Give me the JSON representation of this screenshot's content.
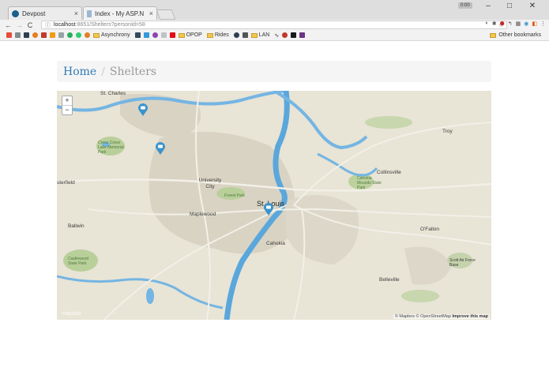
{
  "browser": {
    "tabs": [
      {
        "title": "Devpost",
        "active": false
      },
      {
        "title": "Index - My ASP.NET",
        "active": true
      }
    ],
    "profile_badge": "0:00",
    "url_host": "localhost",
    "url_rest": ":8651/Shelters?personId=58",
    "bookmarks": [
      {
        "label": "Asynchrony",
        "type": "folder"
      },
      {
        "label": "OPOP",
        "type": "folder"
      },
      {
        "label": "Rides",
        "type": "folder"
      },
      {
        "label": "LAN",
        "type": "folder"
      }
    ],
    "other_bookmarks": "Other bookmarks"
  },
  "breadcrumb": {
    "home": "Home",
    "separator": "/",
    "current": "Shelters"
  },
  "map": {
    "zoom_in": "+",
    "zoom_out": "−",
    "attribution_mapbox": "© Mapbox",
    "attribution_osm": "© OpenStreetMap",
    "improve": "Improve this map",
    "logo": "mapbox",
    "labels": {
      "st_charles": "St. Charles",
      "creve_coeur": "Creve Coeur Lake Memorial Park",
      "chesterfield": "sterfield",
      "university_city": "University City",
      "forest_park": "Forest Park",
      "st_louis": "St. Louis",
      "maplewood": "Maplewood",
      "ballwin": "Ballwin",
      "castlewood": "Castlewood State Park",
      "cahokia": "Cahokia",
      "collinsville": "Collinsville",
      "cahokia_mounds": "Cahokia Mounds State Park",
      "troy": "Troy",
      "ofallon": "O'Fallon",
      "scott_afb": "Scott Air Force Base",
      "belleville": "Belleville"
    },
    "marker_icon": "bus-icon",
    "marker_color": "#3b93cc"
  }
}
